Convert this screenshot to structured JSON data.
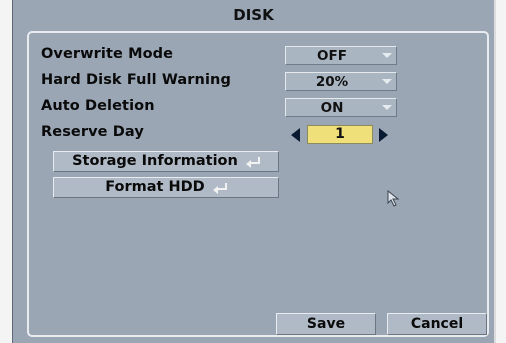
{
  "window": {
    "title": "DISK"
  },
  "settings": {
    "overwrite_mode": {
      "label": "Overwrite Mode",
      "value": "OFF"
    },
    "full_warning": {
      "label": "Hard Disk Full Warning",
      "value": "20%"
    },
    "auto_deletion": {
      "label": "Auto Deletion",
      "value": "ON"
    },
    "reserve_day": {
      "label": "Reserve Day",
      "value": "1"
    }
  },
  "actions": {
    "storage_info": "Storage Information",
    "format_hdd": "Format HDD"
  },
  "footer": {
    "save": "Save",
    "cancel": "Cancel"
  },
  "icons": {
    "dropdown": "chevron-down-icon",
    "decrement": "triangle-left-icon",
    "increment": "triangle-right-icon",
    "enter": "enter-return-icon",
    "cursor": "mouse-pointer-icon"
  },
  "colors": {
    "background": "#9aa6b4",
    "highlight": "#f0e07a",
    "button": "#b0bac6"
  }
}
